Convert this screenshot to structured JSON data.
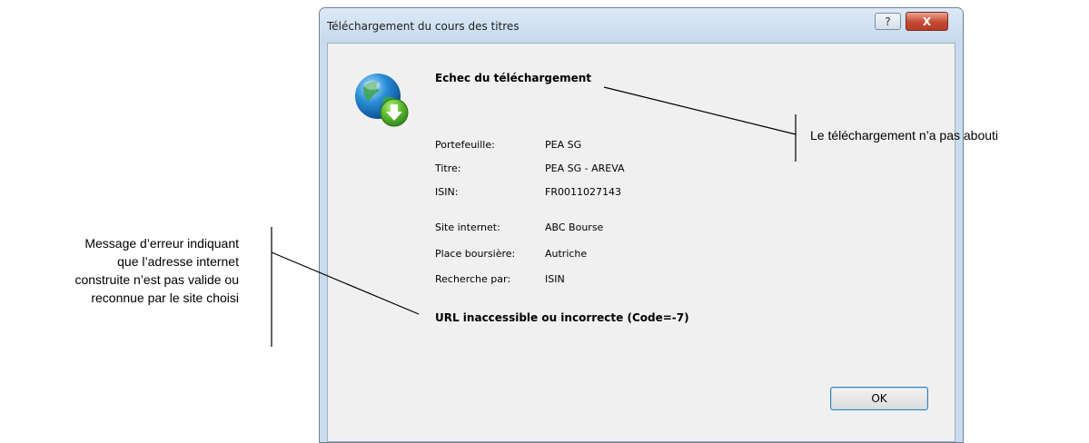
{
  "dialog": {
    "title": "Téléchargement du cours des titres",
    "heading": "Echec du téléchargement",
    "details": [
      {
        "label": "Portefeuille:",
        "value": "PEA SG"
      },
      {
        "label": "Titre:",
        "value": "PEA SG - AREVA"
      },
      {
        "label": "ISIN:",
        "value": "FR0011027143"
      },
      {
        "label": "Site internet:",
        "value": "ABC Bourse"
      },
      {
        "label": "Place boursière:",
        "value": "Autriche"
      },
      {
        "label": "Recherche par:",
        "value": "ISIN"
      }
    ],
    "error": "URL inaccessible ou incorrecte (Code=-7)",
    "ok_label": "OK",
    "help_label": "?",
    "close_label": "X",
    "icon": "globe-download-icon"
  },
  "annotations": {
    "right": "Le téléchargement n’a pas abouti",
    "left": [
      "Message d’erreur indiquant",
      "que l’adresse internet",
      "construite n’est pas valide ou",
      "reconnue par le site choisi"
    ]
  }
}
